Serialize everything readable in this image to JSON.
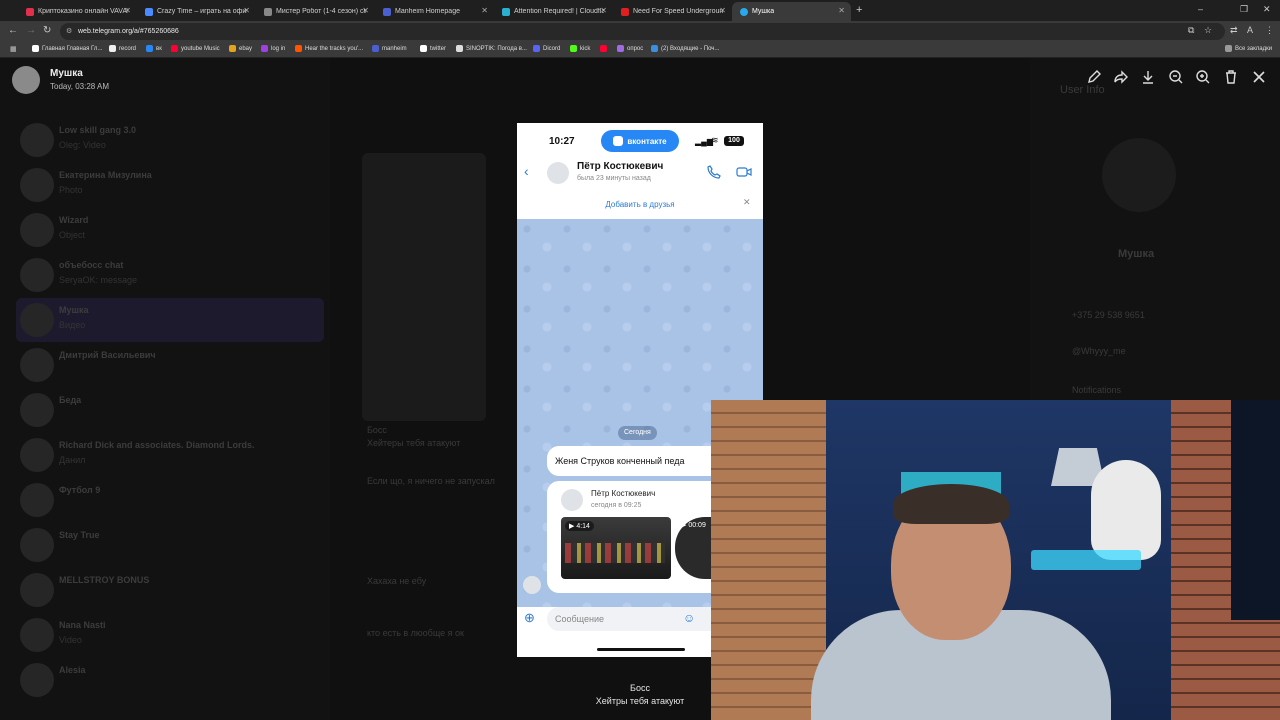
{
  "browser": {
    "tabs": [
      {
        "title": "Криптоказино онлайн VAVADA",
        "color": "#e0304e"
      },
      {
        "title": "Crazy Time – играть на официа...",
        "color": "#4a8cff"
      },
      {
        "title": "Мистер Робот (1-4 сезон) смо...",
        "color": "#888888"
      },
      {
        "title": "Manheim Homepage",
        "color": "#4a5fd0"
      },
      {
        "title": "Attention Required! | Cloudflare",
        "color": "#2ab0d0"
      },
      {
        "title": "Need For Speed Underground 2 ...",
        "color": "#e02020"
      },
      {
        "title": "Мушка",
        "color": "#29a9eb"
      }
    ],
    "new_tab_label": "+",
    "url": "web.telegram.org/a/#765260686",
    "bookmarks": [
      "Главная Главная Гл...",
      "record",
      "вк",
      "youtube Music",
      "ebay",
      "log in",
      "Hear the tracks you'...",
      "manheim",
      "twitter",
      "SINOPTIK: Погода в...",
      "Dicord",
      "kick",
      "опрос",
      "(2) Входящие - Поч..."
    ],
    "all_bookmarks_label": "Все закладки"
  },
  "viewer": {
    "sender_name": "Мушка",
    "date": "Today, 03:28 AM",
    "caption_author": "Босс",
    "caption_text": "Хейтры тебя атакуют"
  },
  "sidebar_chats": [
    {
      "name": "Low skill gang 3.0",
      "preview": "Oleg: Video"
    },
    {
      "name": "Екатерина Мизулина",
      "preview": "Photo"
    },
    {
      "name": "Wizard",
      "preview": "Object"
    },
    {
      "name": "объебосс chat",
      "preview": "SeryaOK: message"
    },
    {
      "name": "Мушка",
      "preview": "Видео"
    },
    {
      "name": "Дмитрий Васильевич",
      "preview": ""
    },
    {
      "name": "Беда",
      "preview": ""
    },
    {
      "name": "Richard Dick and associates. Diamond Lords.",
      "preview": "Данил"
    },
    {
      "name": "Футбол 9",
      "preview": ""
    },
    {
      "name": "Stay True",
      "preview": ""
    },
    {
      "name": "MELLSTROY BONUS",
      "preview": ""
    },
    {
      "name": "Nana Nasti",
      "preview": "Video"
    },
    {
      "name": "Alesia",
      "preview": ""
    }
  ],
  "chat_ghost_texts": [
    "Босс",
    "Хейтеры тебя атакуют",
    "Если що, я ничего не запускал",
    "Хахаха не ебу",
    "кто есть в люобще я ок"
  ],
  "info_panel": {
    "title": "User Info",
    "name": "Мушка",
    "phone": "+375 29 538 9651",
    "username": "@Whyyy_me",
    "notifications": "Notifications"
  },
  "phone": {
    "time": "10:27",
    "app_pill": "вконтакте",
    "battery": "100",
    "contact_name": "Пётр Костюкевич",
    "last_seen": "была 23 минуты назад",
    "add_friend": "Добавить в друзья",
    "date_separator": "Сегодня",
    "message_text": "Женя Струков конченный педа",
    "forward_name": "Пётр Костюкевич",
    "forward_time": "сегодня в 09:25",
    "video1_duration": "4:14",
    "video2_duration": "00:09",
    "input_placeholder": "Сообщение"
  },
  "colors": {
    "vk_blue": "#2787f5",
    "telegram_blue": "#29a9eb",
    "link_blue": "#2a7bd3"
  }
}
